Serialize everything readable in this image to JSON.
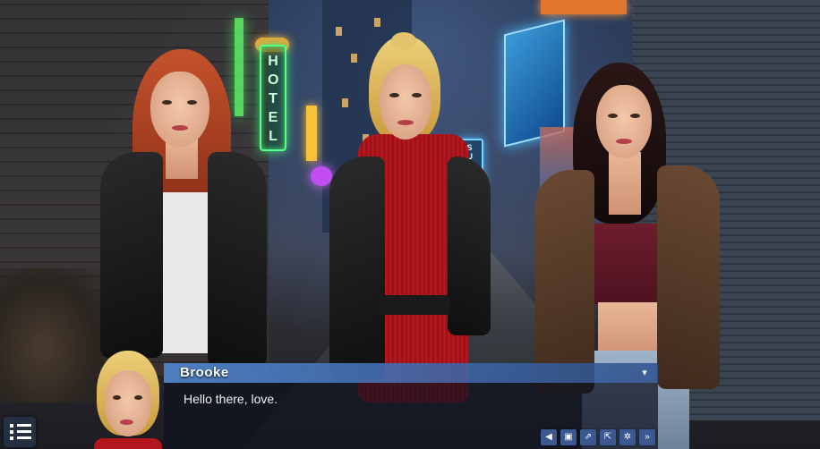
{
  "scene": {
    "signs": {
      "hotel": "HOTEL",
      "sushi": "SUSHI"
    }
  },
  "dialogue": {
    "speaker": "Brooke",
    "text": "Hello there, love."
  },
  "namebox": {
    "collapse_icon": "chevron-down-icon"
  },
  "quick_menu": {
    "buttons": [
      {
        "name": "back-icon",
        "glyph": "◀"
      },
      {
        "name": "save-icon",
        "glyph": "▣"
      },
      {
        "name": "external-link-icon",
        "glyph": "⇗"
      },
      {
        "name": "share-icon",
        "glyph": "⇱"
      },
      {
        "name": "settings-icon",
        "glyph": "✲"
      },
      {
        "name": "skip-icon",
        "glyph": "»"
      }
    ]
  },
  "main_menu": {
    "icon": "list-menu-icon"
  },
  "colors": {
    "namebox": "#5082c8",
    "button": "#3b5890",
    "textbox": "#0e121e"
  }
}
